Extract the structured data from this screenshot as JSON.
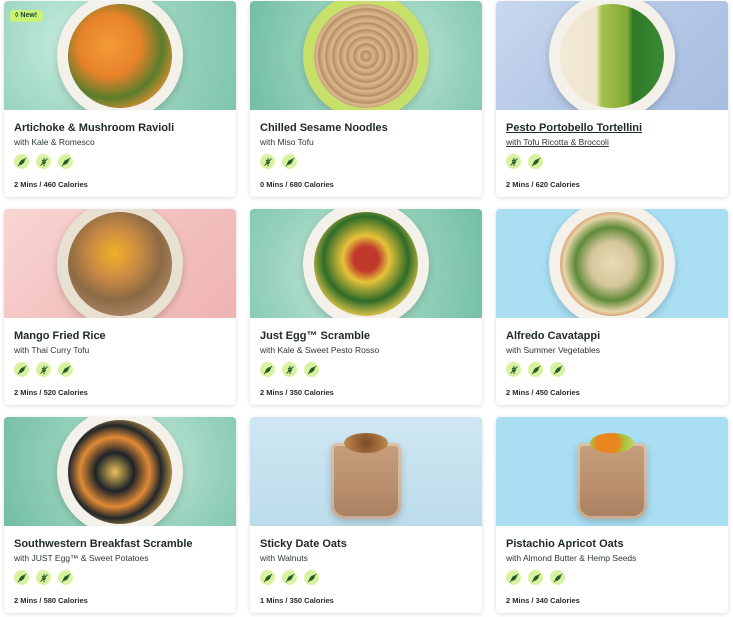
{
  "cards": [
    {
      "title": "Artichoke & Mushroom Ravioli",
      "subtitle": "with Kale & Romesco",
      "meta": "2 Mins / 460 Calories",
      "badge": "New!",
      "tags": [
        "leaf-icon",
        "wheat-icon",
        "leaf-icon"
      ]
    },
    {
      "title": "Chilled Sesame Noodles",
      "subtitle": "with Miso Tofu",
      "meta": "0 Mins / 680 Calories",
      "tags": [
        "wheat-icon",
        "leaf-icon"
      ]
    },
    {
      "title": "Pesto Portobello Tortellini",
      "subtitle": "with Tofu Ricotta & Broccoli",
      "meta": "2 Mins / 620 Calories",
      "tags": [
        "wheat-icon",
        "leaf-icon"
      ]
    },
    {
      "title": "Mango Fried Rice",
      "subtitle": "with Thai Curry Tofu",
      "meta": "2 Mins / 520 Calories",
      "tags": [
        "leaf-icon",
        "wheat-icon",
        "leaf-icon"
      ]
    },
    {
      "title": "Just Egg™ Scramble",
      "subtitle": "with Kale & Sweet Pesto Rosso",
      "meta": "2 Mins / 350 Calories",
      "tags": [
        "leaf-icon",
        "wheat-icon",
        "leaf-icon"
      ]
    },
    {
      "title": "Alfredo Cavatappi",
      "subtitle": "with Summer Vegetables",
      "meta": "2 Mins / 450 Calories",
      "tags": [
        "wheat-icon",
        "leaf-icon",
        "leaf-icon"
      ]
    },
    {
      "title": "Southwestern Breakfast Scramble",
      "subtitle": "with JUST Egg™ & Sweet Potatoes",
      "meta": "2 Mins / 580 Calories",
      "tags": [
        "leaf-icon",
        "wheat-icon",
        "leaf-icon"
      ]
    },
    {
      "title": "Sticky Date Oats",
      "subtitle": "with Walnuts",
      "meta": "1 Mins / 350 Calories",
      "tags": [
        "leaf-icon",
        "leaf-icon",
        "leaf-icon"
      ]
    },
    {
      "title": "Pistachio Apricot Oats",
      "subtitle": "with Almond Butter & Hemp Seeds",
      "meta": "2 Mins / 340 Calories",
      "tags": [
        "leaf-icon",
        "leaf-icon",
        "leaf-icon"
      ]
    }
  ],
  "colors": {
    "badge": "#c6f27a",
    "tag_bg": "#d9f29f",
    "tag_icon": "#2b5a2c",
    "mint_bg": "#a9dcc9",
    "pink_bg": "#f6c9c9",
    "blue_bg": "#a9def3",
    "lightblue_bg": "#c7e4f3"
  }
}
